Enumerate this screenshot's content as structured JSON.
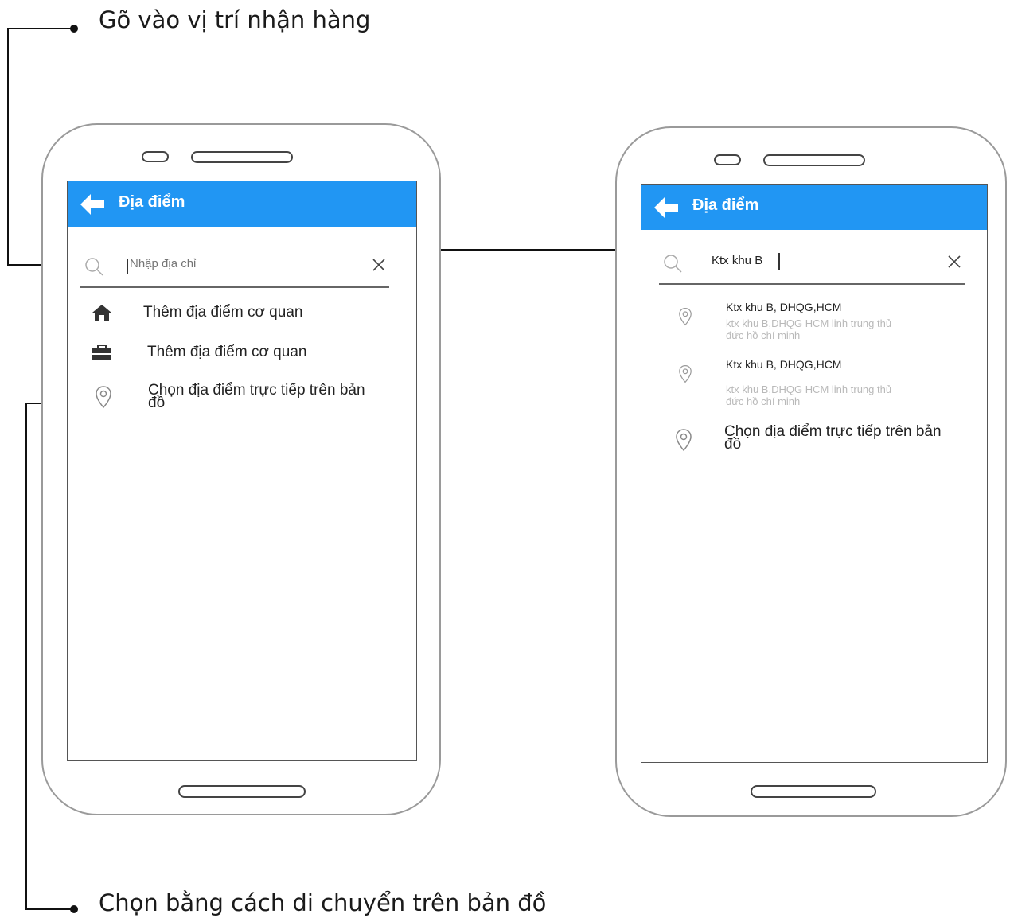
{
  "annotations": {
    "type_location": "Gõ vào vị trí nhận hàng",
    "choose_on_map": "Chọn bằng cách di chuyển trên bản đồ"
  },
  "colors": {
    "appbar": "#2196f3",
    "placeholder": "#b0b0b0",
    "secondary_text": "#b9b9b9"
  },
  "left_screen": {
    "appbar_title": "Địa điểm",
    "search_placeholder": "Nhập địa chỉ",
    "items": [
      {
        "icon": "home-icon",
        "label": "Thêm địa điểm cơ quan"
      },
      {
        "icon": "briefcase-icon",
        "label": "Thêm địa điểm cơ quan"
      },
      {
        "icon": "map-pin-icon",
        "label_line1": "Chọn địa điểm trực tiếp trên bản",
        "label_line2": "đồ"
      }
    ]
  },
  "right_screen": {
    "appbar_title": "Địa điểm",
    "search_value": "Ktx khu B",
    "results": [
      {
        "icon": "map-pin-icon",
        "title": "Ktx khu B, DHQG,HCM",
        "line1": "ktx khu B,DHQG HCM linh trung thủ",
        "line2": "đức hồ chí minh"
      },
      {
        "icon": "map-pin-icon",
        "title": "Ktx khu B, DHQG,HCM",
        "line1": "ktx khu B,DHQG HCM linh trung thủ",
        "line2": "đức hồ chí minh"
      }
    ],
    "map_item": {
      "icon": "map-pin-icon",
      "label_line1": "Chọn địa điểm trực tiếp trên bản",
      "label_line2": "đồ"
    }
  }
}
